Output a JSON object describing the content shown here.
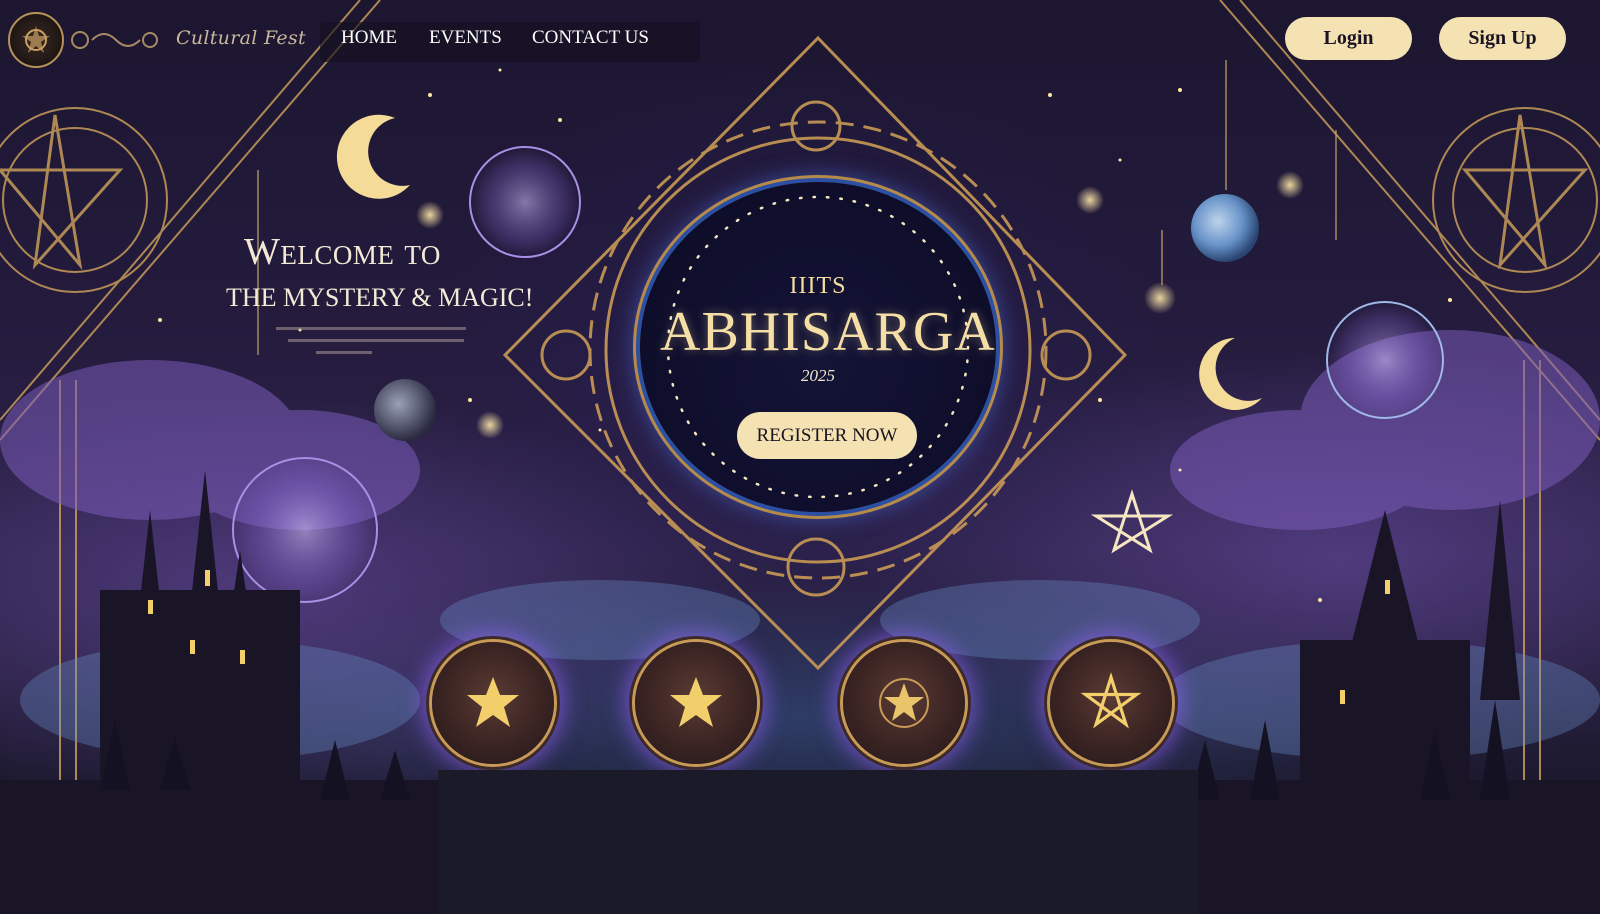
{
  "nav": {
    "brand": "Cultural Fest",
    "links": [
      "HOME",
      "EVENTS",
      "CONTACT US"
    ],
    "login_label": "Login",
    "signup_label": "Sign Up"
  },
  "welcome": {
    "title": "Welcome to",
    "subtitle": "THE MYSTERY & MAGIC!"
  },
  "hero": {
    "org": "IIITS",
    "title": "ABHISARGA",
    "year": "2025",
    "cta_label": "REGISTER NOW"
  },
  "coins": [
    {
      "icon": "star-icon"
    },
    {
      "icon": "star-icon"
    },
    {
      "icon": "star-emblem-icon"
    },
    {
      "icon": "pentagram-icon"
    }
  ],
  "colors": {
    "accent_cream": "#f5e2b2",
    "gold": "#c99a55",
    "deep_navy": "#0f0e2c",
    "purple_glow": "#9664ff"
  }
}
